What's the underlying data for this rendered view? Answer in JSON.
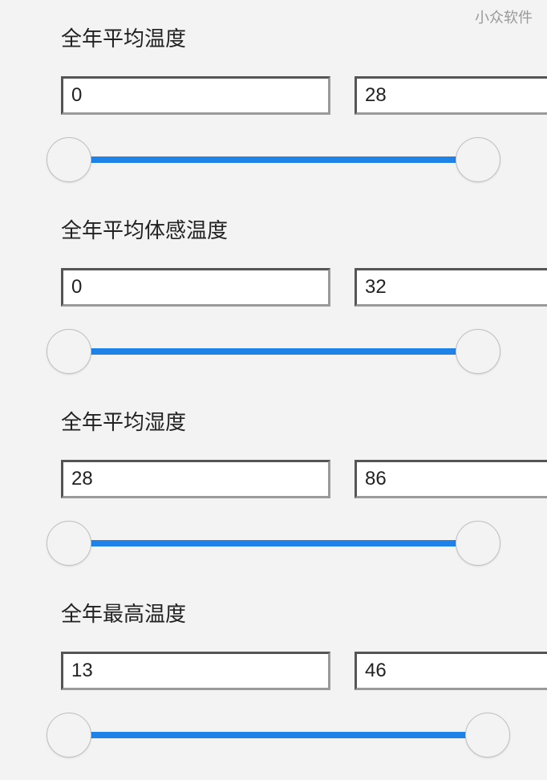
{
  "watermark": "小众软件",
  "filters": [
    {
      "label": "全年平均温度",
      "min": "0",
      "max": "28"
    },
    {
      "label": "全年平均体感温度",
      "min": "0",
      "max": "32"
    },
    {
      "label": "全年平均湿度",
      "min": "28",
      "max": "86"
    },
    {
      "label": "全年最高温度",
      "min": "13",
      "max": "46"
    }
  ]
}
